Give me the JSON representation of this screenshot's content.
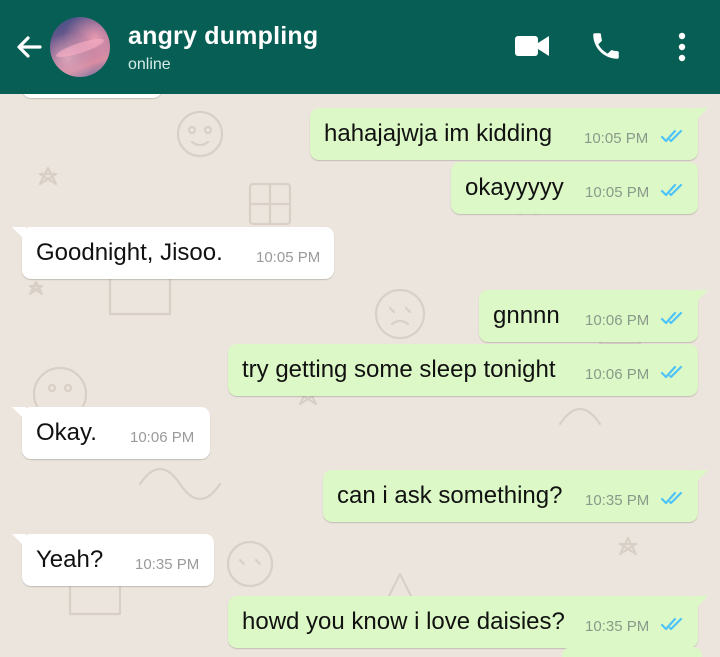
{
  "header": {
    "contact_name": "angry dumpling",
    "status": "online",
    "icons": [
      "back-arrow-icon",
      "avatar",
      "video-call-icon",
      "phone-call-icon",
      "more-vert-icon"
    ],
    "background_color": "#075e54"
  },
  "colors": {
    "outgoing_bubble": "#dcf8c6",
    "incoming_bubble": "#ffffff",
    "read_ticks": "#4fc3f7",
    "chat_background": "#ece5dd"
  },
  "messages": [
    {
      "direction": "out",
      "text": "hahajajwja im kidding",
      "time": "10:05 PM",
      "read": true
    },
    {
      "direction": "out",
      "text": "okayyyyy",
      "time": "10:05 PM",
      "read": true
    },
    {
      "direction": "in",
      "text": "Goodnight, Jisoo.",
      "time": "10:05 PM"
    },
    {
      "direction": "out",
      "text": "gnnnn",
      "time": "10:06 PM",
      "read": true
    },
    {
      "direction": "out",
      "text": "try getting some sleep tonight",
      "time": "10:06 PM",
      "read": true
    },
    {
      "direction": "in",
      "text": "Okay.",
      "time": "10:06 PM"
    },
    {
      "direction": "out",
      "text": "can i ask something?",
      "time": "10:35 PM",
      "read": true
    },
    {
      "direction": "in",
      "text": "Yeah?",
      "time": "10:35 PM"
    },
    {
      "direction": "out",
      "text": "howd you know i love daisies?",
      "time": "10:35 PM",
      "read": true
    }
  ]
}
